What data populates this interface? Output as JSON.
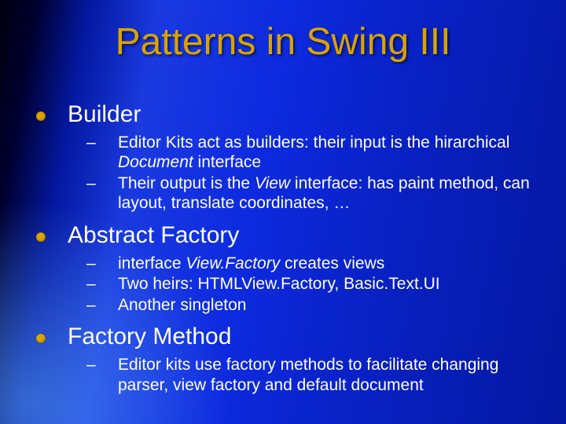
{
  "title": "Patterns in Swing III",
  "sections": [
    {
      "label": "Builder",
      "items": [
        "Editor Kits act as builders: their input is the hirarchical <em>Document</em> interface",
        "Their output is the <em>View</em> interface: has paint method, can layout, translate coordinates, …"
      ]
    },
    {
      "label": "Abstract Factory",
      "items": [
        "interface <em>View.Factory</em> creates views",
        "Two heirs: HTMLView.Factory, Basic.Text.UI",
        "Another singleton"
      ]
    },
    {
      "label": "Factory Method",
      "items": [
        "Editor kits use factory methods to facilitate changing parser, view factory and default document"
      ]
    }
  ]
}
